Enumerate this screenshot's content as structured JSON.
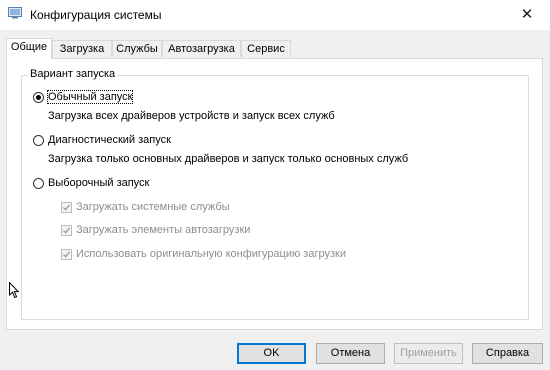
{
  "window": {
    "title": "Конфигурация системы",
    "close_glyph": "✕",
    "icon": "system-config-icon"
  },
  "tabs": [
    {
      "label": "Общие",
      "active": true
    },
    {
      "label": "Загрузка",
      "active": false
    },
    {
      "label": "Службы",
      "active": false
    },
    {
      "label": "Автозагрузка",
      "active": false
    },
    {
      "label": "Сервис",
      "active": false
    }
  ],
  "group": {
    "legend": "Вариант запуска",
    "options": [
      {
        "label": "Обычный запуск",
        "description": "Загрузка всех драйверов устройств и запуск всех служб",
        "selected": true
      },
      {
        "label": "Диагностический запуск",
        "description": "Загрузка только основных драйверов и запуск только основных служб",
        "selected": false
      },
      {
        "label": "Выборочный запуск",
        "selected": false
      }
    ],
    "checks": [
      {
        "label": "Загружать системные службы",
        "checked": true,
        "enabled": false
      },
      {
        "label": "Загружать элементы автозагрузки",
        "checked": true,
        "enabled": false
      },
      {
        "label": "Использовать оригинальную конфигурацию загрузки",
        "checked": true,
        "enabled": false
      }
    ]
  },
  "buttons": {
    "ok": "OK",
    "cancel": "Отмена",
    "apply": "Применить",
    "help": "Справка"
  },
  "colors": {
    "accent": "#0078d7",
    "dialog_bg": "#f0f0f0",
    "disabled_text": "#8d8d8d"
  }
}
